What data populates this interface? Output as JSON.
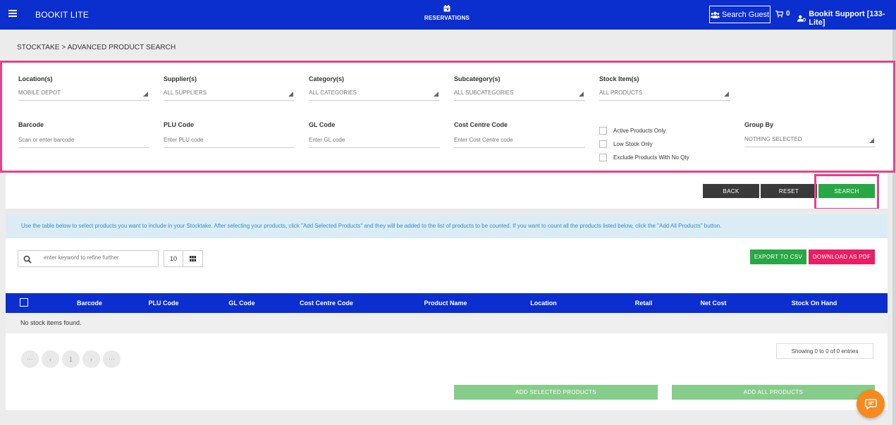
{
  "app": {
    "title": "BOOKIT LITE"
  },
  "header": {
    "reservations_label": "RESERVATIONS",
    "search_guest_label": "Search Guest",
    "cart_count": "0",
    "user_label": "Bookit Support [133-Lite]"
  },
  "breadcrumb": "STOCKTAKE > ADVANCED PRODUCT SEARCH",
  "filters": {
    "location": {
      "label": "Location(s)",
      "value": "MOBILE DEPOT"
    },
    "supplier": {
      "label": "Supplier(s)",
      "value": "ALL SUPPLIERS"
    },
    "category": {
      "label": "Category(s)",
      "value": "ALL CATEGORIES"
    },
    "subcategory": {
      "label": "Subcategory(s)",
      "value": "ALL SUBCATEGORIES"
    },
    "stock_item": {
      "label": "Stock Item(s)",
      "value": "ALL PRODUCTS"
    },
    "barcode": {
      "label": "Barcode",
      "placeholder": "Scan or enter barcode"
    },
    "plu_code": {
      "label": "PLU Code",
      "placeholder": "Enter PLU code"
    },
    "gl_code": {
      "label": "GL Code",
      "placeholder": "Enter GL code"
    },
    "cost_centre_code": {
      "label": "Cost Centre Code",
      "placeholder": "Enter Cost Centre code"
    },
    "checkboxes": [
      {
        "label": "Active Products Only",
        "checked": false
      },
      {
        "label": "Low Stock Only",
        "checked": false
      },
      {
        "label": "Exclude Products With No Qty",
        "checked": false
      }
    ],
    "group_by": {
      "label": "Group By",
      "value": "NOTHING SELECTED"
    }
  },
  "actions": {
    "back": "BACK",
    "reset": "RESET",
    "search": "SEARCH"
  },
  "info_text": "Use the table below to select products you want to include in your Stocktake. After selecting your products, click \"Add Selected Products\" and they will be added to the list of products to be counted. If you want to count all the products listed below, click the \"Add All Products\" button.",
  "table": {
    "refine_placeholder": "enter keyword to refine further",
    "page_size": "10",
    "export_csv": "EXPORT TO CSV",
    "download_pdf": "DOWNLOAD AS PDF",
    "columns": [
      "Barcode",
      "PLU Code",
      "GL Code",
      "Cost Centre Code",
      "Product Name",
      "Location",
      "Retail",
      "Net Cost",
      "Stock On Hand"
    ],
    "empty_message": "No stock items found.",
    "pagination": {
      "first": "⋯",
      "prev": "‹",
      "current": "1",
      "next": "›",
      "last": "⋯"
    },
    "showing": "Showing 0 to 0 of 0 entries",
    "add_selected": "ADD SELECTED PRODUCTS",
    "add_all": "ADD ALL PRODUCTS"
  },
  "colors": {
    "header_blue": "#0b2ecf",
    "highlight_pink": "#e1458a",
    "green": "#28a745",
    "pink_button": "#ea1e63",
    "chat_orange": "#f78a1d"
  }
}
